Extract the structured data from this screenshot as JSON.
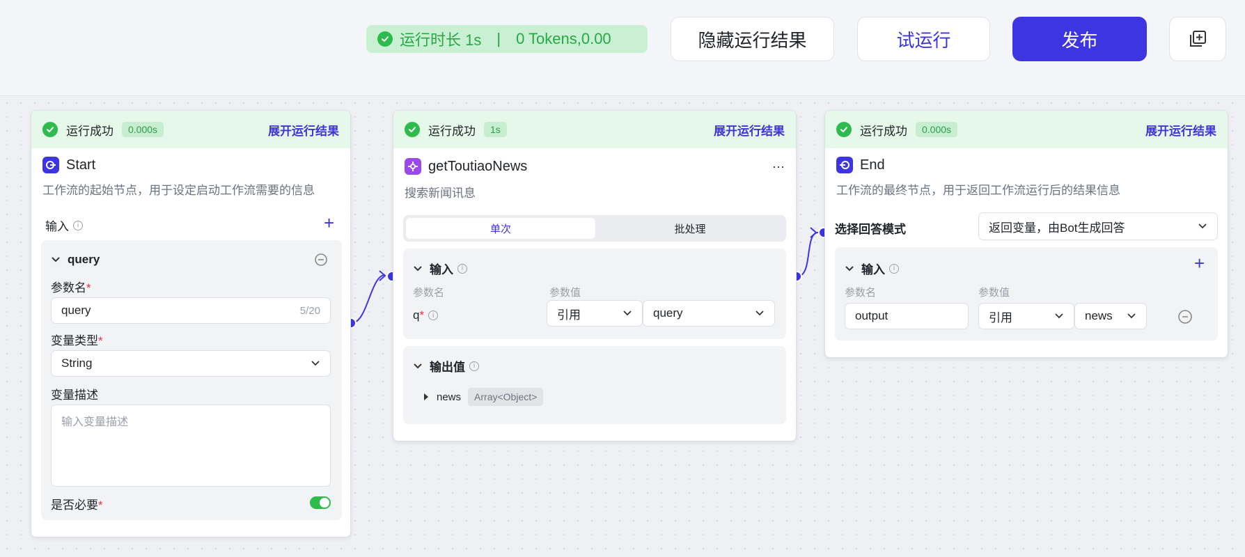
{
  "toolbar": {
    "run_duration": "运行时长 1s",
    "tokens": "0 Tokens,0.00",
    "hide_results": "隐藏运行结果",
    "test_run": "试运行",
    "publish": "发布"
  },
  "nodes": {
    "start": {
      "status": "运行成功",
      "time": "0.000s",
      "expand": "展开运行结果",
      "title": "Start",
      "desc": "工作流的起始节点，用于设定启动工作流需要的信息",
      "input_label": "输入",
      "param_header": "query",
      "param_name_label": "参数名",
      "param_name_value": "query",
      "param_name_count": "5/20",
      "var_type_label": "变量类型",
      "var_type_value": "String",
      "var_desc_label": "变量描述",
      "var_desc_placeholder": "输入变量描述",
      "required_label": "是否必要",
      "required_on": true
    },
    "tool": {
      "status": "运行成功",
      "time": "1s",
      "expand": "展开运行结果",
      "title": "getToutiaoNews",
      "more": "···",
      "desc": "搜索新闻讯息",
      "tab_single": "单次",
      "tab_batch": "批处理",
      "input_label": "输入",
      "col_name": "参数名",
      "col_value": "参数值",
      "param_q": "q",
      "ref_type": "引用",
      "ref_value": "query",
      "output_label": "输出值",
      "output_name": "news",
      "output_type": "Array<Object>"
    },
    "end": {
      "status": "运行成功",
      "time": "0.000s",
      "expand": "展开运行结果",
      "title": "End",
      "desc": "工作流的最终节点，用于返回工作流运行后的结果信息",
      "mode_label": "选择回答模式",
      "mode_value": "返回变量，由Bot生成回答",
      "input_label": "输入",
      "col_name": "参数名",
      "col_value": "参数值",
      "param_name": "output",
      "ref_type": "引用",
      "ref_value": "news"
    }
  },
  "colors": {
    "accent": "#3d35e0",
    "success": "#2dbb4e",
    "success_bg": "#e6f8ea"
  }
}
